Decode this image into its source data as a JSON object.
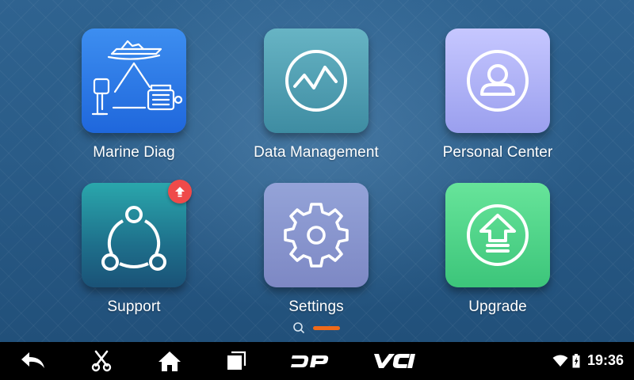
{
  "apps": [
    {
      "label": "Marine Diag",
      "icon": "marine-diagnostics-icon"
    },
    {
      "label": "Data Management",
      "icon": "waveform-chart-icon"
    },
    {
      "label": "Personal Center",
      "icon": "user-profile-icon"
    },
    {
      "label": "Support",
      "icon": "share-network-icon",
      "badge_icon": "update-arrow-icon"
    },
    {
      "label": "Settings",
      "icon": "gear-icon"
    },
    {
      "label": "Upgrade",
      "icon": "upgrade-arrow-icon"
    }
  ],
  "pager": {
    "current_page": 1,
    "search_icon": "search-icon"
  },
  "navbar": {
    "buttons": [
      {
        "name": "back-icon"
      },
      {
        "name": "scissors-icon"
      },
      {
        "name": "home-icon"
      },
      {
        "name": "recent-apps-icon"
      },
      {
        "name": "dp-logo",
        "text": "DP"
      },
      {
        "name": "vci-logo",
        "text": "VCI"
      }
    ],
    "status": {
      "wifi_icon": "wifi-icon",
      "battery_icon": "battery-icon",
      "time": "19:36"
    }
  },
  "colors": {
    "badge": "#ef4a4a",
    "page_indicator": "#ef6a1a",
    "navbar": "#000000"
  }
}
